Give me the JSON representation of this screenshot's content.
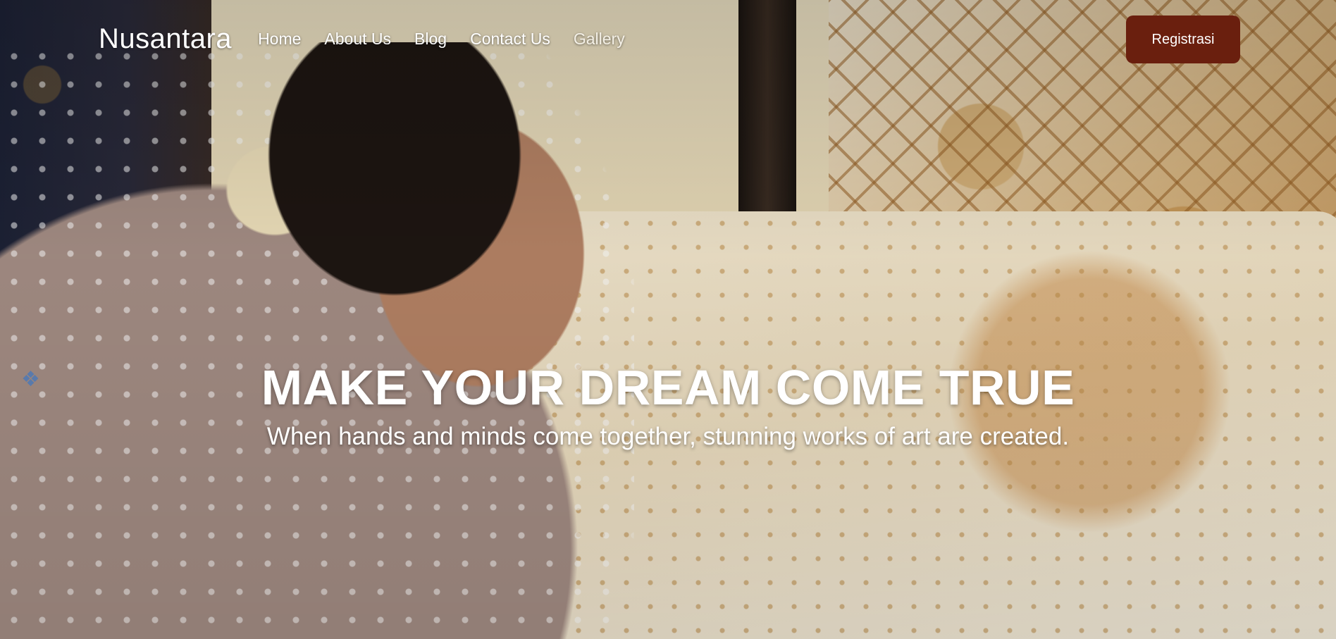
{
  "navbar": {
    "brand": "Nusantara",
    "links": [
      {
        "label": "Home"
      },
      {
        "label": "About Us"
      },
      {
        "label": "Blog"
      },
      {
        "label": "Contact Us"
      },
      {
        "label": "Gallery"
      }
    ],
    "cta_label": "Registrasi"
  },
  "hero": {
    "title": "MAKE YOUR DREAM COME TRUE",
    "subtitle": "When hands and minds come together, stunning works of art are created."
  },
  "colors": {
    "cta_background": "#6a1f0e",
    "text": "#ffffff"
  },
  "icons": {
    "side_glyph": "layers-icon"
  }
}
